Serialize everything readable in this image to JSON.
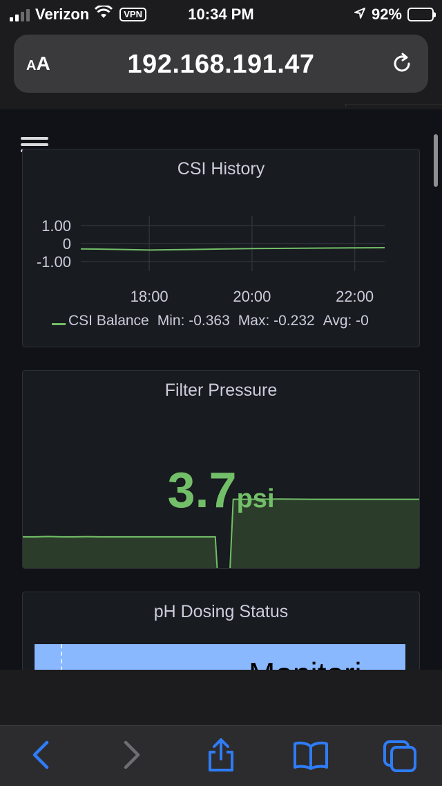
{
  "status_bar": {
    "carrier": "Verizon",
    "vpn": "VPN",
    "time": "10:34 PM",
    "battery_percent": "92%",
    "battery_level": 0.92,
    "signal_bars_active": 2
  },
  "browser": {
    "text_size_label": "AA",
    "url": "192.168.191.47"
  },
  "panels": {
    "csi": {
      "title": "CSI History"
    },
    "filter": {
      "title": "Filter Pressure",
      "value": "3.7",
      "unit": "psi"
    },
    "ph": {
      "title": "pH Dosing Status",
      "status_text": "Monitori"
    }
  },
  "chart_data": [
    {
      "type": "line",
      "title": "CSI History",
      "y_ticks": [
        "1.00",
        "0",
        "-1.00"
      ],
      "ylim": [
        -1.0,
        1.0
      ],
      "x_ticks": [
        "18:00",
        "20:00",
        "22:00"
      ],
      "x": [
        "16:40",
        "17:00",
        "17:30",
        "18:00",
        "18:30",
        "19:00",
        "19:30",
        "20:00",
        "20:30",
        "21:00",
        "21:30",
        "22:00",
        "22:35"
      ],
      "series": [
        {
          "name": "CSI Balance",
          "color": "#73bf69",
          "values": [
            -0.3,
            -0.31,
            -0.33,
            -0.36,
            -0.34,
            -0.32,
            -0.3,
            -0.28,
            -0.27,
            -0.26,
            -0.25,
            -0.24,
            -0.23
          ]
        }
      ],
      "legend": {
        "series_name": "CSI Balance",
        "min": "Min: -0.363",
        "max": "Max: -0.232",
        "avg": "Avg: -0"
      },
      "grid": true
    },
    {
      "type": "area",
      "title": "Filter Pressure",
      "color": "#73bf69",
      "fill": "#2b3d2a",
      "ylim": [
        0,
        7
      ],
      "values": [
        1.7,
        1.7,
        1.72,
        1.7,
        1.7,
        1.71,
        1.7,
        1.7,
        1.7,
        1.7,
        1.7,
        1.7,
        0.0,
        0.0,
        3.7,
        3.7,
        3.71,
        3.7,
        3.7,
        3.7,
        3.7,
        3.7
      ],
      "x": [
        0,
        2,
        4,
        6,
        8,
        10,
        12,
        14,
        16,
        18,
        20,
        30,
        30.3,
        32.3,
        32.8,
        35,
        40,
        45,
        50,
        55,
        60,
        62
      ]
    }
  ]
}
